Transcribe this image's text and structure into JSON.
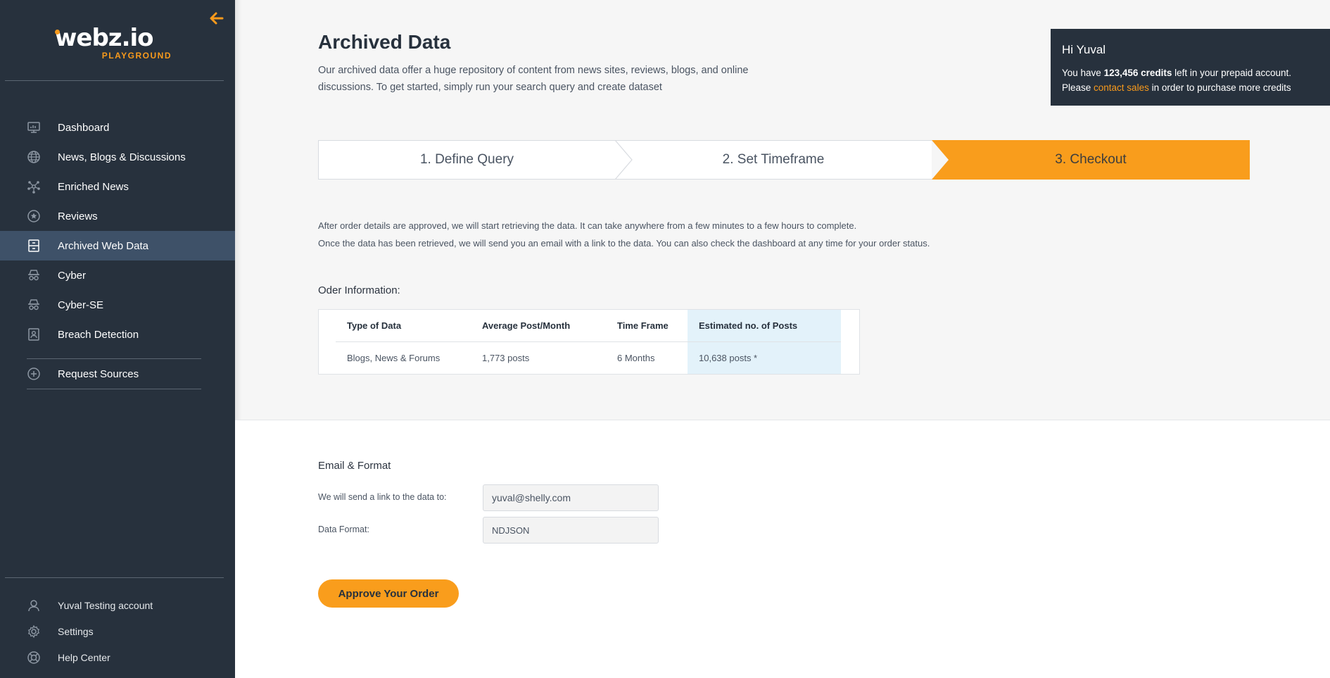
{
  "brand": {
    "logo_text": "webz.io",
    "logo_sub": "PLAYGROUND",
    "accent": "#f89a1c"
  },
  "sidebar": {
    "items": [
      {
        "label": "Dashboard",
        "icon": "monitor-icon"
      },
      {
        "label": "News, Blogs & Discussions",
        "icon": "globe-icon"
      },
      {
        "label": "Enriched News",
        "icon": "network-icon"
      },
      {
        "label": "Reviews",
        "icon": "star-circle-icon"
      },
      {
        "label": "Archived Web Data",
        "icon": "archive-icon",
        "active": true
      },
      {
        "label": "Cyber",
        "icon": "spy-icon"
      },
      {
        "label": "Cyber-SE",
        "icon": "spy-icon"
      },
      {
        "label": "Breach Detection",
        "icon": "badge-icon"
      }
    ],
    "request_sources": "Request Sources",
    "bottom": [
      {
        "label": "Yuval Testing account",
        "icon": "user-icon"
      },
      {
        "label": "Settings",
        "icon": "gear-icon"
      },
      {
        "label": "Help Center",
        "icon": "lifebuoy-icon"
      }
    ]
  },
  "header": {
    "title": "Archived Data",
    "description": "Our archived data offer a huge repository of content from news sites, reviews, blogs, and online discussions. To get started, simply run your search query and create dataset"
  },
  "credits": {
    "greeting": "Hi Yuval",
    "line1_prefix": "You have ",
    "amount": "123,456 credits",
    "line1_suffix": " left in your prepaid account.",
    "line2_prefix": "Please ",
    "link": "contact sales",
    "line2_suffix": " in order to purchase more credits"
  },
  "steps": [
    {
      "label": "1. Define Query"
    },
    {
      "label": "2. Set Timeframe"
    },
    {
      "label": "3. Checkout",
      "active": true
    }
  ],
  "info": {
    "line1": "After order details are approved, we will start retrieving the data. It can take anywhere from a few minutes to a few hours to complete.",
    "line2": "Once the data has been retrieved, we will send you an email with a link to the data. You can also check the dashboard at any time for your order status."
  },
  "order": {
    "label": "Oder Information:",
    "headers": [
      "Type of Data",
      "Average Post/Month",
      "Time Frame",
      "Estimated no. of Posts"
    ],
    "row": [
      "Blogs, News & Forums",
      "1,773 posts",
      "6 Months",
      "10,638 posts *"
    ]
  },
  "email_format": {
    "title": "Email & Format",
    "email_label": "We will send a link to the data to:",
    "email_value": "yuval@shelly.com",
    "format_label": "Data Format:",
    "format_value": "NDJSON"
  },
  "approve_label": "Approve Your Order"
}
